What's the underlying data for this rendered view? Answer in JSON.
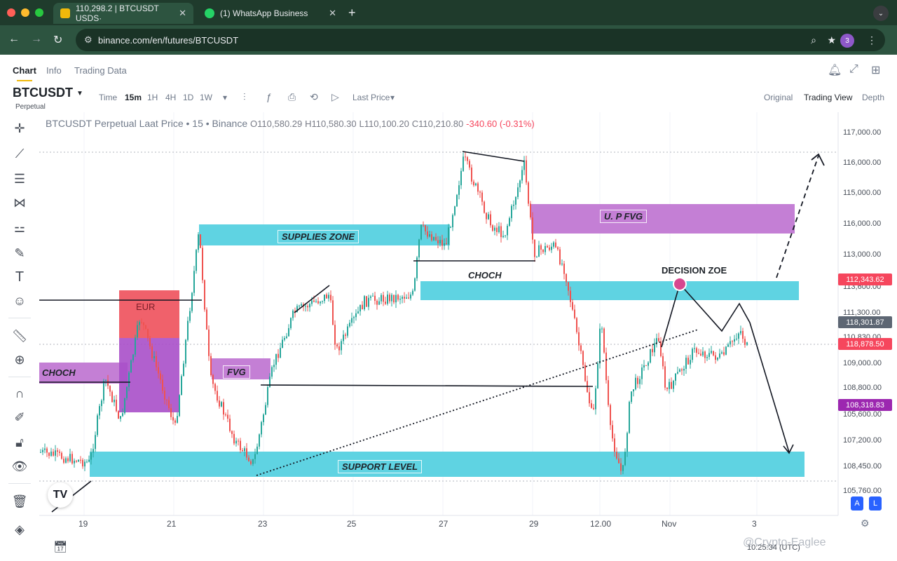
{
  "browser": {
    "tabs": [
      {
        "title": "110,298.2 | BTCUSDT USDS·",
        "favicon_color": "#f0b90b",
        "active": true
      },
      {
        "title": "(1) WhatsApp Business",
        "favicon_color": "#25d366",
        "active": false
      }
    ],
    "url": "binance.com/en/futures/BTCUSDT",
    "profile_initial": "3"
  },
  "subnav": {
    "tabs": [
      "Chart",
      "Info",
      "Trading Data"
    ]
  },
  "symbol": {
    "name": "BTCUSDT",
    "type": "Perpetual"
  },
  "toolbar": {
    "time_label": "Time",
    "intervals": [
      "15m",
      "1H",
      "4H",
      "1D",
      "1W"
    ],
    "active_interval": "15m",
    "price_type": "Last Price",
    "views": [
      "Original",
      "Trading View",
      "Depth"
    ],
    "active_view": "Trading View"
  },
  "legend": {
    "title": "BTCUSDT Perpetual Laat Price • 15 • Binance",
    "open": "O110,580.29",
    "high": "H110,580.30",
    "low": "L110,100.20",
    "close": "C110,210.80",
    "change": "-340.60 (-0.31%)"
  },
  "price_axis": [
    "117,000.00",
    "116,000.00",
    "115,000.00",
    "116,000.00",
    "113,000.00",
    "113,600.00",
    "111,300.00",
    "110,830.00",
    "109,000.00",
    "108,800.00",
    "105,600.00",
    "107,200.00",
    "108,450.00",
    "105,760.00"
  ],
  "price_badges": [
    {
      "text": "112,343.62",
      "color": "#f6465d"
    },
    {
      "text": "118,301.87",
      "color": "#5d6673"
    },
    {
      "text": "118,878.50",
      "color": "#f6465d"
    },
    {
      "text": "108,318.83",
      "color": "#9c27b0"
    }
  ],
  "time_axis": [
    "19",
    "21",
    "23",
    "25",
    "27",
    "29",
    "12.00",
    "Nov",
    "3"
  ],
  "annotations": {
    "supplies_zone": "SUPPLIES ZONE",
    "up_fvg": "U. P FVG",
    "decision_zone": "DECISION ZOE",
    "support_level": "SUPPORT LEVEL",
    "choch_left": "CHOCH",
    "choch_mid": "CHOCH",
    "fvg": "FVG",
    "eur": "EUR"
  },
  "colors": {
    "zone_cyan": "#5fd3e2",
    "zone_purple": "#c47fd5",
    "zone_red": "#f0616b",
    "up": "#26a69a",
    "down": "#ef5350"
  },
  "watermark": "@Crypto-Eaglee",
  "clock": "10:25:34 (UTC)",
  "chart_buttons": {
    "a": "A",
    "l": "L"
  },
  "icons": [
    "crosshair-icon",
    "trendline-icon",
    "fib-icon",
    "pattern-icon",
    "measure-tools-icon",
    "brush-icon",
    "text-icon",
    "emoji-icon",
    "ruler-icon",
    "zoom-icon",
    "magnet-icon",
    "lock-drawings-icon",
    "lock-icon",
    "eye-icon",
    "trash-icon",
    "layers-icon",
    "bell-icon",
    "expand-icon",
    "grid-icon",
    "calendar-icon",
    "settings-icon"
  ]
}
